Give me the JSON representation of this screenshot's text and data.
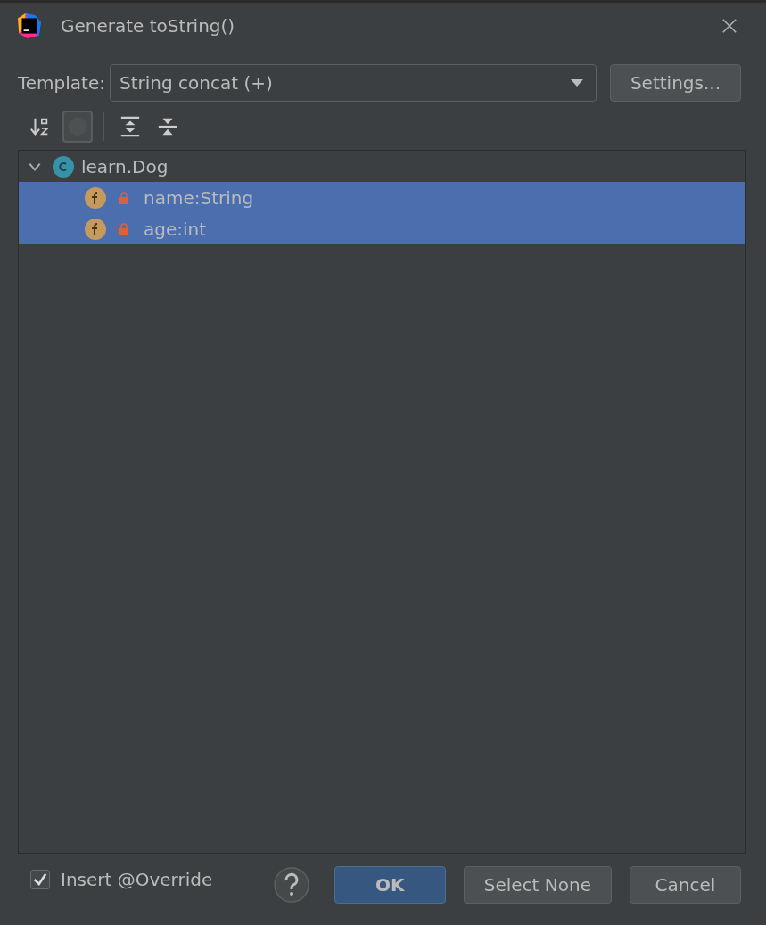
{
  "window": {
    "title": "Generate toString()"
  },
  "template": {
    "label": "Template:",
    "value": "String concat (+)",
    "settings_button": "Settings..."
  },
  "toolbar": [
    {
      "kind": "sort",
      "selected": false
    },
    {
      "kind": "toggle",
      "selected": true
    },
    {
      "kind": "expand",
      "selected": false
    },
    {
      "kind": "collapse",
      "selected": false
    }
  ],
  "tree": [
    {
      "label": "learn.Dog",
      "kind": "class",
      "expanded": true,
      "selected": false,
      "children": [
        {
          "label": "name:String",
          "kind": "field",
          "selected": true
        },
        {
          "label": "age:int",
          "kind": "field",
          "selected": true
        }
      ]
    }
  ],
  "insert_override": {
    "label": "Insert @Override",
    "checked": true
  },
  "buttons": [
    {
      "label": "OK",
      "kind": "primary"
    },
    {
      "label": "Select None",
      "kind": "normal"
    },
    {
      "label": "Cancel",
      "kind": "normal"
    }
  ]
}
